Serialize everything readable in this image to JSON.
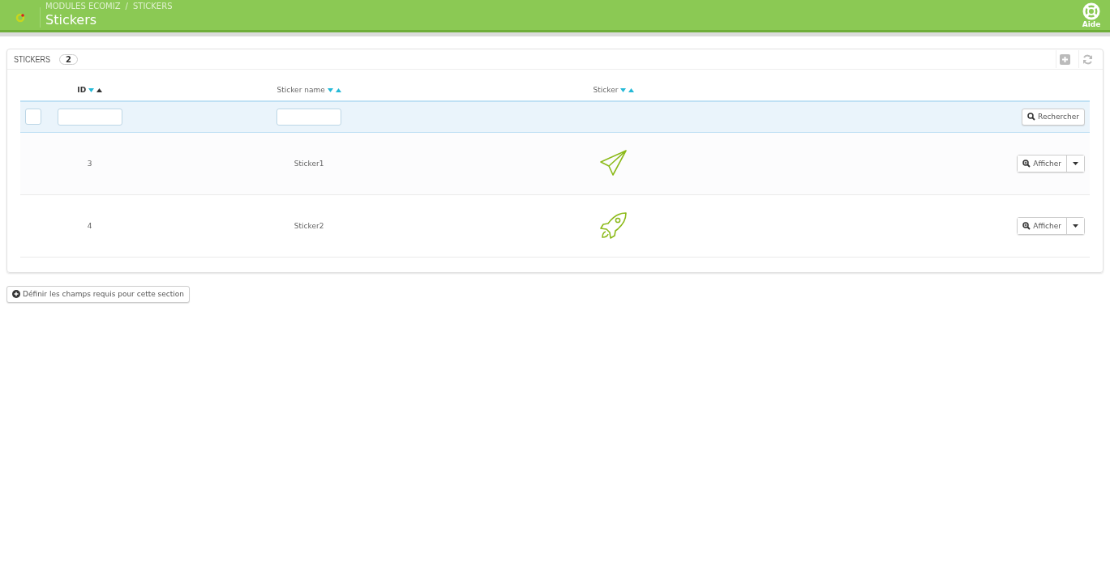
{
  "header": {
    "breadcrumb": [
      "MODULES ECOMIZ",
      "STICKERS"
    ],
    "breadcrumb_separator": "/",
    "title": "Stickers",
    "help_label": "Aide"
  },
  "panel": {
    "title": "STICKERS",
    "count": "2"
  },
  "table": {
    "columns": [
      {
        "label": "ID",
        "sorted_ascending": true
      },
      {
        "label": "Sticker name",
        "sorted_ascending": false
      },
      {
        "label": "Sticker",
        "sorted_ascending": false
      }
    ],
    "select_all_checked": false,
    "search_button": "Rechercher",
    "rows": [
      {
        "id": "3",
        "name": "Sticker1",
        "kind": "plane",
        "action": "Afficher"
      },
      {
        "id": "4",
        "name": "Sticker2",
        "kind": "rocket",
        "action": "Afficher"
      }
    ]
  },
  "footer_button": "Définir les champs requis pour cette section"
}
